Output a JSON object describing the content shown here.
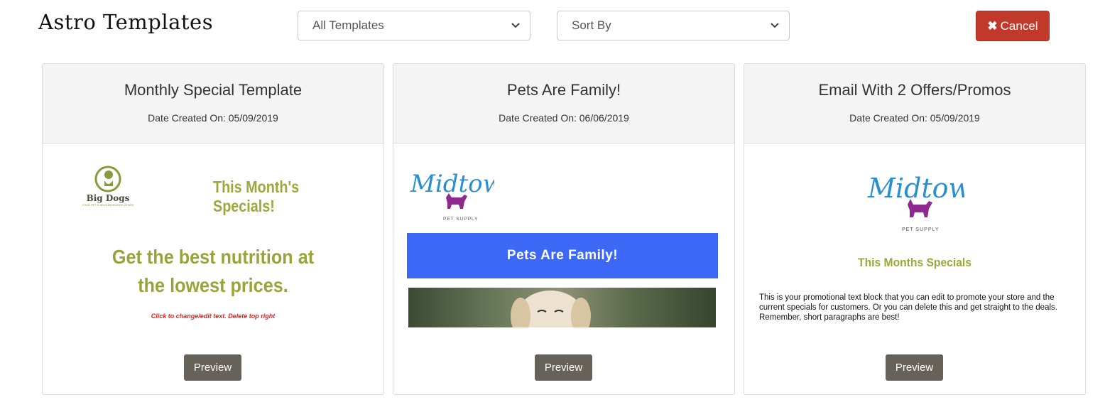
{
  "header": {
    "title": "Astro Templates",
    "filter_select": {
      "value": "All Templates"
    },
    "sort_select": {
      "value": "Sort By"
    },
    "cancel_label": "Cancel"
  },
  "colors": {
    "cancel": "#c0392b",
    "preview_button": "#666259",
    "banner_blue": "#3d68f5",
    "olive": "#9aaa3a"
  },
  "templates": [
    {
      "title": "Monthly Special Template",
      "date": "Date Created On: 05/09/2019",
      "preview_label": "Preview",
      "thumbnail": {
        "logo_name": "Big Dogs",
        "logo_tagline": "YOUR PET'S NEIGHBORHOOD STORE",
        "heading": "This Month's Specials!",
        "headline_line1": "Get the best nutrition at",
        "headline_line2": "the lowest prices.",
        "note": "Click to change/edit text. Delete top right"
      }
    },
    {
      "title": "Pets Are Family!",
      "date": "Date Created On: 06/06/2019",
      "preview_label": "Preview",
      "thumbnail": {
        "logo_name": "Midtown",
        "logo_sub": "PET SUPPLY",
        "banner": "Pets Are Family!"
      }
    },
    {
      "title": "Email With 2 Offers/Promos",
      "date": "Date Created On: 05/09/2019",
      "preview_label": "Preview",
      "thumbnail": {
        "logo_name": "Midtown",
        "logo_sub": "PET SUPPLY",
        "heading": "This Months Specials",
        "body": "This is your promotional text block that you can edit to promote your store and the current specials for customers. Or you can delete this and get straight to the deals. Remember, short paragraphs are best!"
      }
    }
  ]
}
